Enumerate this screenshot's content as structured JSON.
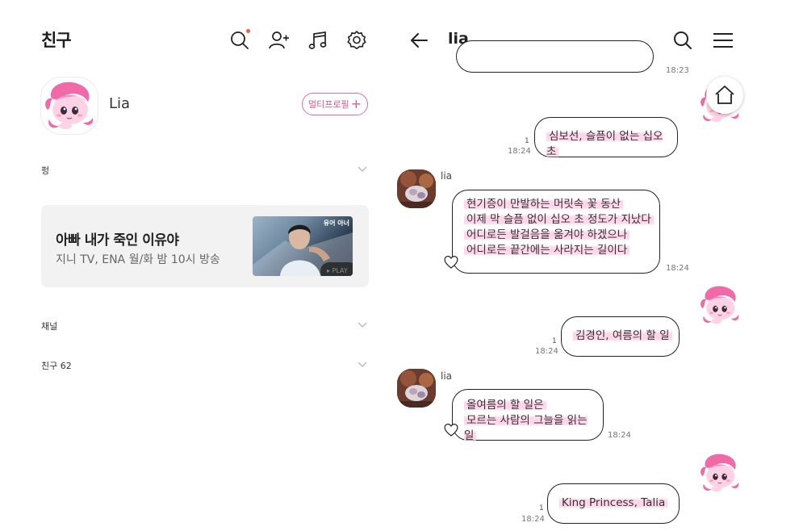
{
  "left": {
    "title": "친구",
    "profile": {
      "name": "Lia",
      "multi_profile_label": "멀티프로필",
      "multi_profile_plus": "+"
    },
    "sections": {
      "first": "펑",
      "channel": "채널",
      "friends": "친구 62"
    },
    "banner": {
      "title": "아빠 내가 죽인 이유야",
      "subtitle": "지니 TV, ENA 월/화 밤 10시 방송",
      "thumb_logo": "유어 아너",
      "play_label": "▸ PLAY"
    },
    "icons": [
      "search-icon",
      "add-friend-icon",
      "music-icon",
      "settings-icon",
      "chevron-down-icon"
    ]
  },
  "right": {
    "chat_title": "lia",
    "top_partial_time": "18:23",
    "messages": [
      {
        "side": "me",
        "text": "심보선, 슬픔이 없는 십오 초",
        "time": "18:24",
        "read": "1"
      },
      {
        "side": "other",
        "sender": "lia",
        "lines": [
          "현기증이 만발하는 머릿속 꽃 동산",
          "이제 막 슬픔 없이 십오 초 정도가 지났다",
          "어디로든 발걸음을 옮겨야 하겠으나",
          "어디로든 끝간에는 사라지는 길이다"
        ],
        "time": "18:24"
      },
      {
        "side": "me",
        "text": "김경인, 여름의 할 일",
        "time": "18:24",
        "read": "1"
      },
      {
        "side": "other",
        "sender": "lia",
        "lines": [
          "올여름의 할 일은",
          "모르는 사람의 그늘을 읽는 일"
        ],
        "time": "18:24"
      },
      {
        "side": "me",
        "text": "King Princess, Talia",
        "time": "18:24",
        "read": "1"
      }
    ],
    "icons": [
      "back-arrow-icon",
      "search-icon",
      "menu-icon",
      "home-icon",
      "heart-icon"
    ]
  },
  "colors": {
    "accent_pink": "#ef6aa0",
    "highlight_pink": "#ffd6ea",
    "notification_dot": "#ff5a3c"
  }
}
